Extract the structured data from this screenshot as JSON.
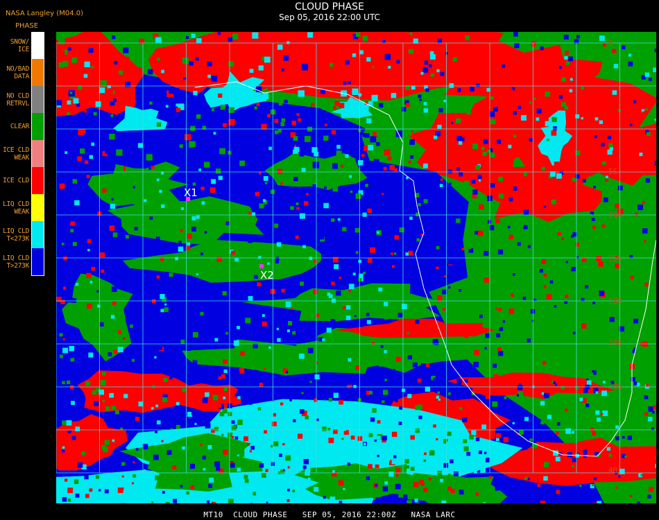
{
  "header": {
    "source": "NASA Langley (M04.0)",
    "title": "CLOUD PHASE",
    "subtitle": "Sep 05, 2016 22:00 UTC"
  },
  "legend": {
    "title": "PHASE",
    "items": [
      {
        "label": "SNOW/\nICE",
        "color": "#ffffff"
      },
      {
        "label": "NO/BAD\nDATA",
        "color": "#f07800"
      },
      {
        "label": "NO CLD\nRETRVL",
        "color": "#808080"
      },
      {
        "label": "CLEAR",
        "color": "#00a000"
      },
      {
        "label": "ICE CLD\nWEAK",
        "color": "#f08080"
      },
      {
        "label": "ICE CLD",
        "color": "#ff0000"
      },
      {
        "label": "LIQ CLD\nWEAK",
        "color": "#ffff00"
      },
      {
        "label": "LIQ CLD\nT<273K",
        "color": "#00e8f0"
      },
      {
        "label": "LIQ CLD\nT>273K",
        "color": "#0000e0"
      }
    ]
  },
  "map": {
    "markers": [
      {
        "label": "X1"
      },
      {
        "label": "X2"
      }
    ],
    "lat_labels": [
      "0",
      "5S",
      "10S",
      "15S",
      "20S",
      "25S",
      "30S",
      "40"
    ],
    "grid_color": "#40e0e0",
    "coast_color": "#ffffff"
  },
  "footer": "MT10  CLOUD PHASE   SEP 05, 2016 22:00Z   NASA LARC"
}
